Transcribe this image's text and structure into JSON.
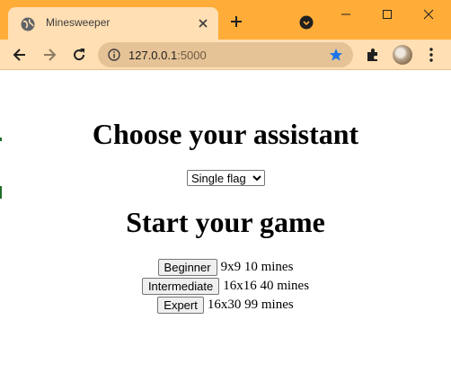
{
  "browser": {
    "tab": {
      "title": "Minesweeper",
      "favicon": "globe-icon"
    },
    "address": {
      "host": "127.0.0.1",
      "port": ":5000"
    },
    "colors": {
      "frame": "#ffad38",
      "toolbar": "#ffdfb3",
      "omnibox": "#e6c396",
      "star": "#1a73e8"
    }
  },
  "page": {
    "assistant_heading": "Choose your assistant",
    "assistant_select": {
      "selected": "Single flag"
    },
    "game_heading": "Start your game",
    "games": [
      {
        "label": "Beginner",
        "info": "9x9 10 mines"
      },
      {
        "label": "Intermediate",
        "info": "16x16 40 mines"
      },
      {
        "label": "Expert",
        "info": "16x30 99 mines"
      }
    ]
  }
}
